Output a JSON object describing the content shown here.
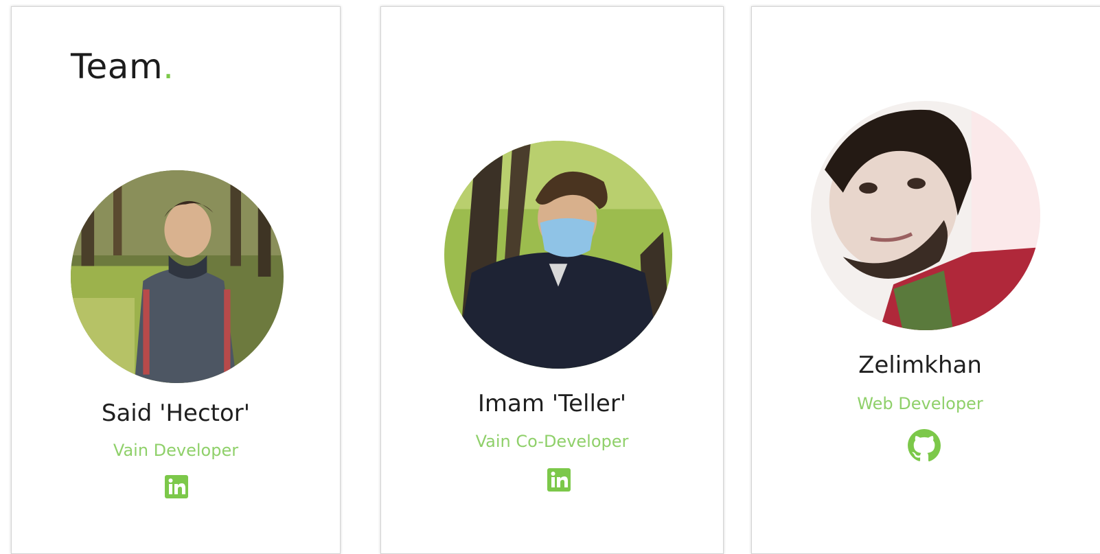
{
  "header": {
    "title_word": "Team",
    "title_dot": "."
  },
  "colors": {
    "accent": "#7cc84a",
    "role_text": "#8fd06a",
    "name_text": "#1f1f1f"
  },
  "members": [
    {
      "name": "Said 'Hector'",
      "role": "Vain Developer",
      "social_icon": "linkedin-icon"
    },
    {
      "name": "Imam 'Teller'",
      "role": "Vain Co-Developer",
      "social_icon": "linkedin-icon"
    },
    {
      "name": "Zelimkhan",
      "role": "Web Developer",
      "social_icon": "github-icon"
    }
  ]
}
